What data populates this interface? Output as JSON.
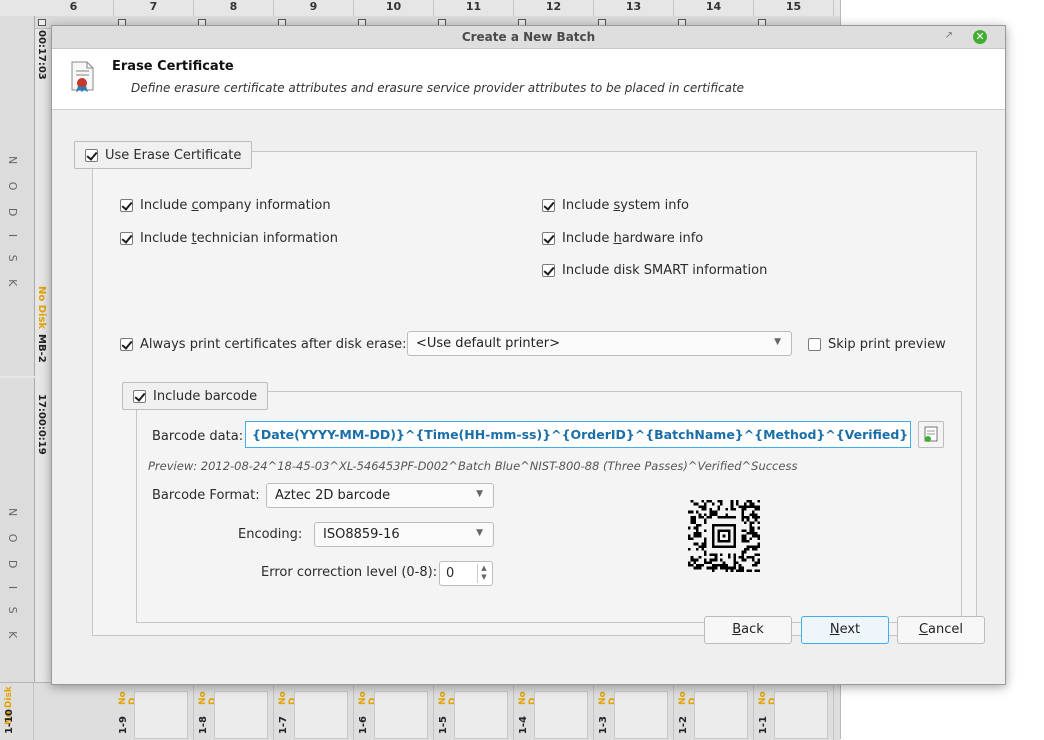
{
  "background": {
    "columns": [
      "6",
      "7",
      "8",
      "9",
      "10",
      "11",
      "12",
      "13",
      "14",
      "15"
    ],
    "left_panels": [
      {
        "timer": "00:17:03",
        "status": "No Disk",
        "id": "MB-2",
        "watermark": "N O D I S K"
      },
      {
        "timer": "17:00:0:19",
        "status": "",
        "id": "",
        "watermark": "N O D I S K"
      }
    ],
    "bottom_slots": [
      {
        "id": "1-10",
        "status": "No Disk"
      },
      {
        "id": "1-9",
        "status": "No D"
      },
      {
        "id": "1-8",
        "status": "No D"
      },
      {
        "id": "1-7",
        "status": "No D"
      },
      {
        "id": "1-6",
        "status": "No D"
      },
      {
        "id": "1-5",
        "status": "No D"
      },
      {
        "id": "1-4",
        "status": "No D"
      },
      {
        "id": "1-3",
        "status": "No D"
      },
      {
        "id": "1-2",
        "status": "No D"
      },
      {
        "id": "1-1",
        "status": "No D"
      }
    ]
  },
  "dialog": {
    "title": "Create a New Batch",
    "header_title": "Erase Certificate",
    "header_subtitle": "Define erasure certificate attributes and erasure service provider attributes to be placed in certificate",
    "use_certificate": {
      "label": "Use Erase Certificate",
      "checked": true
    },
    "left_options": [
      {
        "pre": "Include ",
        "ul": "c",
        "post": "ompany information",
        "checked": true
      },
      {
        "pre": "Include ",
        "ul": "t",
        "post": "echnician information",
        "checked": true
      }
    ],
    "right_options": [
      {
        "pre": "Include ",
        "ul": "s",
        "post": "ystem info",
        "checked": true
      },
      {
        "pre": "Include ",
        "ul": "h",
        "post": "ardware info",
        "checked": true
      },
      {
        "pre": "Include disk SMART information",
        "ul": "",
        "post": "",
        "checked": true
      }
    ],
    "always_print": {
      "label": "Always print certificates after disk erase:",
      "checked": true
    },
    "printer_select": "<Use default printer>",
    "skip_preview": {
      "label": "Skip print preview",
      "checked": false
    },
    "include_barcode": {
      "label": "Include barcode",
      "checked": true
    },
    "barcode_data_label": "Barcode data:",
    "barcode_data_value": "{Date(YYYY-MM-DD)}^{Time(HH-mm-ss)}^{OrderID}^{BatchName}^{Method}^{Verified}^{Status}",
    "preview_text": "Preview: 2012-08-24^18-45-03^XL-546453PF-D002^Batch Blue^NIST-800-88 (Three Passes)^Verified^Success",
    "barcode_format_label": "Barcode Format:",
    "barcode_format_value": "Aztec 2D barcode",
    "encoding_label": "Encoding:",
    "encoding_value": "ISO8859-16",
    "error_level_label": "Error correction level (0-8):",
    "error_level_value": "0",
    "buttons": {
      "back": {
        "ul": "B",
        "rest": "ack"
      },
      "next": {
        "ul": "N",
        "rest": "ext"
      },
      "cancel": {
        "ul": "C",
        "rest": "ancel"
      }
    },
    "colors": {
      "accent": "#3daee9",
      "close_button": "#3fae2f",
      "barcode_text": "#1a6fa8",
      "no_disk": "#e3a300"
    }
  }
}
